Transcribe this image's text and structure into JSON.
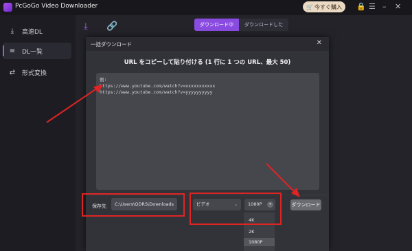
{
  "app": {
    "title": "PcGoGo Video Downloader",
    "buy_label": "今すぐ購入",
    "cart_icon": "cart-icon"
  },
  "window_controls": {
    "lock": "🔒",
    "menu": "☰",
    "minimize": "–",
    "close": "✕"
  },
  "sidebar": {
    "items": [
      {
        "label": "高速DL",
        "icon": "download-icon"
      },
      {
        "label": "DL一覧",
        "icon": "list-icon",
        "active": true
      },
      {
        "label": "形式変換",
        "icon": "convert-icon"
      }
    ]
  },
  "main": {
    "tabs": [
      {
        "label": "ダウンロード中",
        "active": true
      },
      {
        "label": "ダウンロードした",
        "active": false
      }
    ]
  },
  "dialog": {
    "title": "一括ダウンロード",
    "heading": "URL をコピーして貼り付ける (1 行に 1 つの URL、最大 50)",
    "example_text": "例:\nhttps://www.youtube.com/watch?v=xxxxxxxxxxx\nhttps://www.youtube.com/watch?v=yyyyyyyyyy",
    "save_label": "保存先",
    "save_path": "C:\\Users\\QDRS\\Downloads",
    "type_value": "ビデオ",
    "resolution_value": "1080P",
    "download_label": "ダウンロード",
    "resolution_options": [
      "4K",
      "2K",
      "1080P"
    ],
    "selected_option": "1080P"
  },
  "colors": {
    "accent": "#8a4ce0",
    "annotation": "#e02424",
    "buy_button": "#ead9c3"
  }
}
